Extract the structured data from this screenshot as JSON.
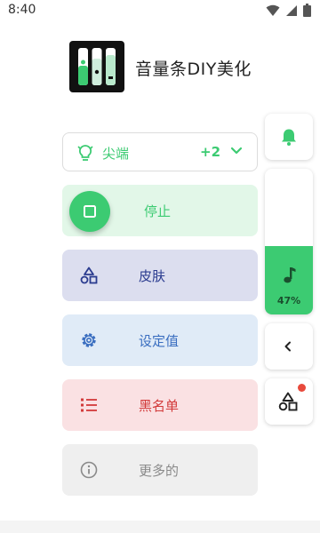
{
  "status_bar": {
    "time": "8:40",
    "icons": [
      "wifi-icon",
      "signal-icon",
      "battery-icon"
    ]
  },
  "app": {
    "title": "音量条DIY美化",
    "logo_icon": "equalizer-sliders-logo"
  },
  "preset": {
    "label": "尖端",
    "count": "+2",
    "icon": "lightbulb-icon"
  },
  "menu": {
    "stop": {
      "label": "停止",
      "icon": "stop-icon"
    },
    "skin": {
      "label": "皮肤",
      "icon": "shapes-icon"
    },
    "settings": {
      "label": "设定值",
      "icon": "gear-icon"
    },
    "blacklist": {
      "label": "黑名单",
      "icon": "list-icon"
    },
    "more": {
      "label": "更多的",
      "icon": "info-icon"
    }
  },
  "volume_panel": {
    "level_percent": 47,
    "percent_label": "47%"
  },
  "colors": {
    "accent_green": "#3ccb72",
    "skin_blue": "#2a3b8f",
    "settings_blue": "#3a6ec0",
    "blacklist_red": "#d23a3a",
    "notification_red": "#e84a3c"
  }
}
